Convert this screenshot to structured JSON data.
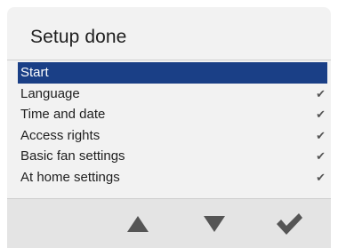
{
  "header": {
    "title": "Setup done"
  },
  "menu": {
    "items": [
      {
        "label": "Start",
        "selected": true,
        "done": false
      },
      {
        "label": "Language",
        "selected": false,
        "done": true
      },
      {
        "label": "Time and date",
        "selected": false,
        "done": true
      },
      {
        "label": "Access rights",
        "selected": false,
        "done": true
      },
      {
        "label": "Basic fan settings",
        "selected": false,
        "done": true
      },
      {
        "label": "At home settings",
        "selected": false,
        "done": true
      }
    ],
    "check_glyph": "✔"
  },
  "footer": {
    "buttons": [
      {
        "name": "up-button",
        "icon": "arrow-up-icon"
      },
      {
        "name": "down-button",
        "icon": "arrow-down-icon"
      },
      {
        "name": "confirm-button",
        "icon": "checkmark-icon"
      }
    ]
  },
  "colors": {
    "selection": "#1a3f86",
    "icon": "#555555",
    "background": "#f2f2f2",
    "footer": "#e4e4e4"
  }
}
